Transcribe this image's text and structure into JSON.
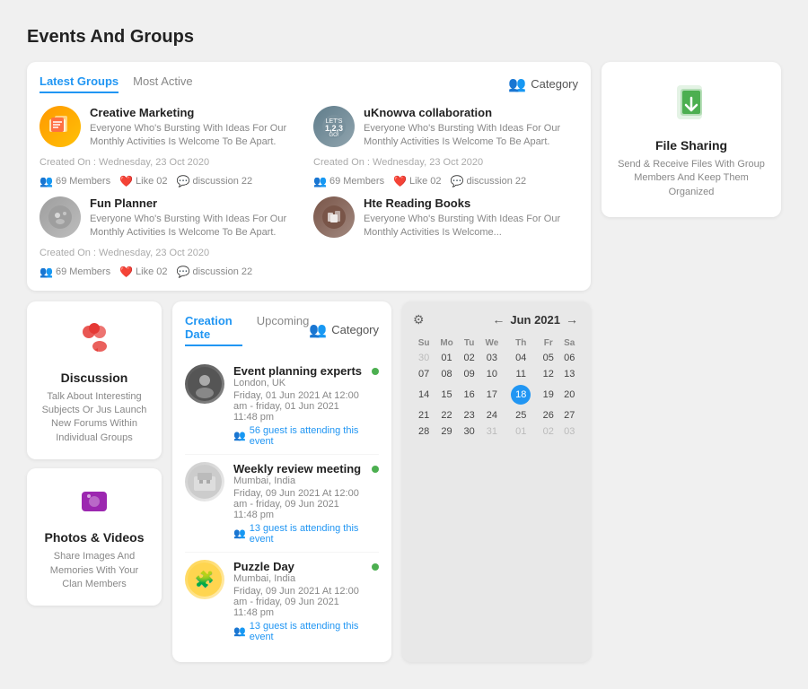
{
  "page": {
    "title": "Events And Groups"
  },
  "groups_panel": {
    "tabs": [
      {
        "label": "Latest Groups",
        "active": true
      },
      {
        "label": "Most Active",
        "active": false
      }
    ],
    "category_label": "Category",
    "groups": [
      {
        "id": 1,
        "name": "Creative Marketing",
        "desc": "Everyone Who's Bursting With Ideas For Our Monthly Activities Is Welcome To Be Apart.",
        "created": "Created On : Wednesday, 23 Oct 2020",
        "members": "69 Members",
        "likes": "Like 02",
        "discussion": "discussion 22",
        "avatar_type": "creative"
      },
      {
        "id": 2,
        "name": "uKnowva collaboration",
        "desc": "Everyone Who's Bursting With Ideas For Our Monthly Activities Is Welcome To Be Apart.",
        "created": "Created On : Wednesday, 23 Oct 2020",
        "members": "69 Members",
        "likes": "Like 02",
        "discussion": "discussion 22",
        "avatar_type": "uknowva"
      },
      {
        "id": 3,
        "name": "Fun Planner",
        "desc": "Everyone Who's Bursting With Ideas For Our Monthly Activities Is Welcome To Be Apart.",
        "created": "Created On : Wednesday, 23 Oct 2020",
        "members": "69 Members",
        "likes": "Like 02",
        "discussion": "discussion 22",
        "avatar_type": "fun"
      },
      {
        "id": 4,
        "name": "Hte Reading Books",
        "desc": "Everyone Who's Bursting With Ideas For Our Monthly Activities Is Welcome...",
        "created": "",
        "members": "",
        "likes": "",
        "discussion": "",
        "avatar_type": "reading"
      }
    ]
  },
  "discussion_card": {
    "title": "Discussion",
    "desc": "Talk About Interesting Subjects Or Jus Launch New Forums Within Individual Groups"
  },
  "photos_card": {
    "title": "Photos & Videos",
    "desc": "Share Images And Memories With Your Clan Members"
  },
  "file_sharing_card": {
    "title": "File Sharing",
    "desc": "Send & Receive Files With Group Members And Keep Them Organized"
  },
  "events_panel": {
    "tabs": [
      {
        "label": "Creation Date",
        "active": true
      },
      {
        "label": "Upcoming",
        "active": false
      }
    ],
    "category_label": "Category",
    "events": [
      {
        "id": 1,
        "name": "Event planning experts",
        "location": "London, UK",
        "time": "Friday, 01 Jun 2021 At 12:00 am - friday, 01 Jun 2021 11:48 pm",
        "guests": "56 guest is attending this event",
        "status": "active"
      },
      {
        "id": 2,
        "name": "Weekly review meeting",
        "location": "Mumbai, India",
        "time": "Friday, 09 Jun 2021 At 12:00 am - friday, 09 Jun 2021 11:48 pm",
        "guests": "13 guest is attending this event",
        "status": "active"
      },
      {
        "id": 3,
        "name": "Puzzle Day",
        "location": "Mumbai, India",
        "time": "Friday, 09 Jun 2021 At 12:00 am - friday, 09 Jun 2021 11:48 pm",
        "guests": "13 guest is attending this event",
        "status": "active"
      }
    ]
  },
  "calendar": {
    "month": "Jun 2021",
    "days_of_week": [
      "Su",
      "Mo",
      "Tu",
      "We",
      "Th",
      "Fr",
      "Sa"
    ],
    "weeks": [
      [
        "30",
        "01",
        "02",
        "03",
        "04",
        "05",
        "06"
      ],
      [
        "07",
        "08",
        "09",
        "10",
        "11",
        "12",
        "13"
      ],
      [
        "14",
        "15",
        "16",
        "17",
        "18",
        "19",
        "20"
      ],
      [
        "21",
        "22",
        "23",
        "24",
        "25",
        "26",
        "27"
      ],
      [
        "28",
        "29",
        "30",
        "31",
        "01",
        "02",
        "03"
      ]
    ],
    "today": "18",
    "other_start": [
      "30"
    ],
    "other_end": [
      "31",
      "01",
      "02",
      "03"
    ]
  }
}
